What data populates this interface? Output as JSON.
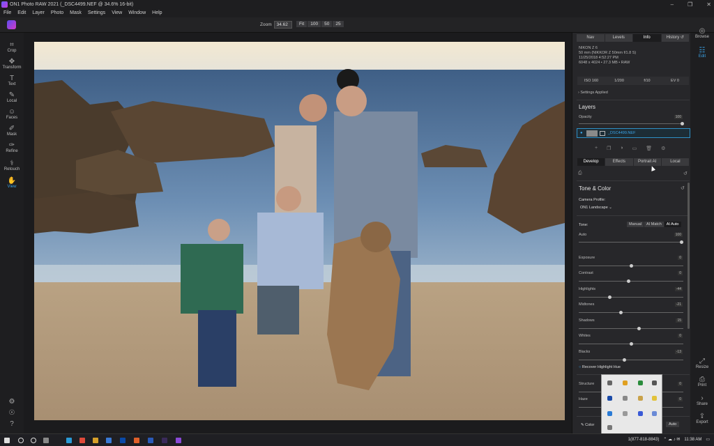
{
  "window": {
    "title": "ON1 Photo RAW 2021 (_DSC4499.NEF @ 34.6% 16-bit)"
  },
  "menu": [
    "File",
    "Edit",
    "Layer",
    "Photo",
    "Mask",
    "Settings",
    "View",
    "Window",
    "Help"
  ],
  "zoom": {
    "label": "Zoom",
    "value": "34.62",
    "fit_options": [
      "Fit",
      "100",
      "50",
      "25"
    ]
  },
  "left_tools": [
    {
      "label": "Crop",
      "icon": "crop-icon"
    },
    {
      "label": "Transform",
      "icon": "transform-icon"
    },
    {
      "label": "Text",
      "icon": "text-icon"
    },
    {
      "label": "Local",
      "icon": "brush-icon"
    },
    {
      "label": "Faces",
      "icon": "face-icon"
    },
    {
      "label": "Mask",
      "icon": "mask-icon"
    },
    {
      "label": "Refine",
      "icon": "refine-icon"
    },
    {
      "label": "Retouch",
      "icon": "retouch-icon"
    },
    {
      "label": "View",
      "icon": "view-icon"
    }
  ],
  "right_tools": [
    {
      "label": "Browse",
      "icon": "binoculars-icon"
    },
    {
      "label": "Edit",
      "icon": "sliders-icon"
    },
    {
      "label": "Resize",
      "icon": "resize-icon"
    },
    {
      "label": "Print",
      "icon": "print-icon"
    },
    {
      "label": "Share",
      "icon": "share-icon"
    },
    {
      "label": "Export",
      "icon": "export-icon"
    }
  ],
  "panel": {
    "tabs": [
      "Nav",
      "Levels",
      "Info",
      "History"
    ],
    "active_tab": "Info",
    "info": {
      "camera": "NIKON Z 6",
      "lens": "50 mm (NIKKOR Z 50mm f/1.8 S)",
      "date": "11/25/2018 4:52:27 PM",
      "dims": "6048 x 4024 • 27.3 MB • RAW",
      "iso": "ISO 160",
      "shutter": "1/200",
      "aperture": "f/10",
      "ev": "EV 0"
    },
    "settings_applied": "Settings Applied",
    "layers": {
      "title": "Layers",
      "opacity_label": "Opacity",
      "opacity_value": "100",
      "layer_name": "_DSC4499.NEF"
    },
    "subtabs": [
      "Develop",
      "Effects",
      "Portrait AI",
      "Local"
    ],
    "tone_color": {
      "title": "Tone & Color",
      "camera_profile_label": "Camera Profile:",
      "camera_profile_value": "ON1 Landscape",
      "tone_label": "Tone:",
      "tone_buttons": [
        "Manual",
        "AI Match",
        "AI Auto"
      ],
      "sliders": [
        {
          "label": "Auto",
          "value": "100"
        },
        {
          "label": "Exposure",
          "value": "0"
        },
        {
          "label": "Contrast",
          "value": "0"
        },
        {
          "label": "Highlights",
          "value": "-44"
        },
        {
          "label": "Midtones",
          "value": "-21"
        },
        {
          "label": "Shadows",
          "value": "15"
        },
        {
          "label": "Whites",
          "value": "0"
        },
        {
          "label": "Blacks",
          "value": "-13"
        }
      ],
      "recover_label": "Recover Highlight Hue",
      "structure_label": "Structure",
      "structure_value": "0",
      "haze_label": "Haze",
      "haze_value": "0",
      "color_label": "Color",
      "auto_label": "Auto"
    }
  },
  "taskbar": {
    "phone": "1(877-818-8843)",
    "time": "11:38 AM"
  }
}
